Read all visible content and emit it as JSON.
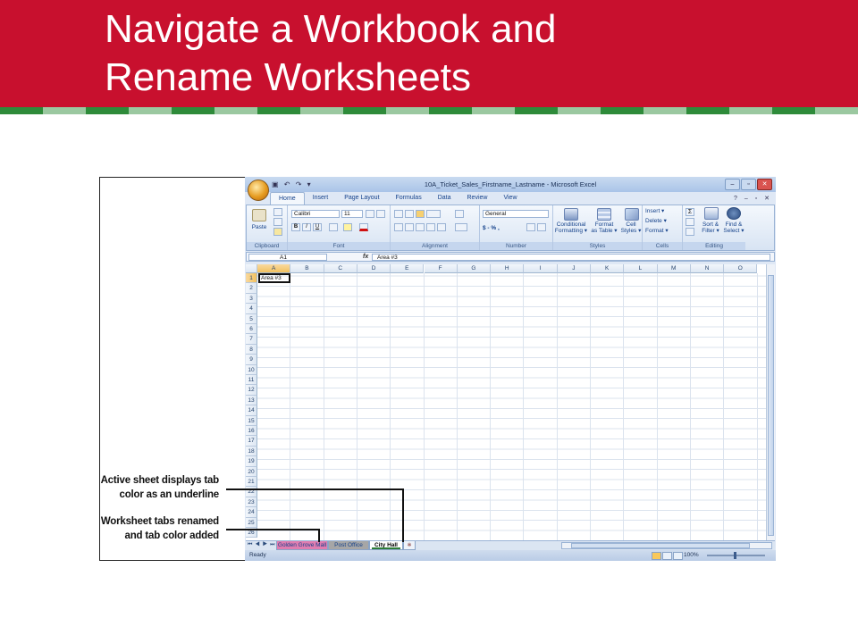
{
  "slide": {
    "title_line1": "Navigate a Workbook and",
    "title_line2": "Rename Worksheets",
    "header_color": "#c8102e"
  },
  "callouts": [
    {
      "line1": "Active sheet displays tab",
      "line2": "color as an underline"
    },
    {
      "line1": "Worksheet tabs renamed",
      "line2": "and tab color added"
    }
  ],
  "excel": {
    "window_title": "10A_Ticket_Sales_Firstname_Lastname - Microsoft Excel",
    "ribbon_tabs": [
      "Home",
      "Insert",
      "Page Layout",
      "Formulas",
      "Data",
      "Review",
      "View"
    ],
    "active_tab": "Home",
    "groups": {
      "clipboard": {
        "label": "Clipboard",
        "paste": "Paste"
      },
      "font": {
        "label": "Font",
        "font_name": "Calibri",
        "font_size": "11"
      },
      "alignment": {
        "label": "Alignment"
      },
      "number": {
        "label": "Number",
        "format": "General",
        "currency": "$ - %  ,"
      },
      "styles": {
        "label": "Styles",
        "conditional": "Conditional",
        "conditional2": "Formatting ▾",
        "format_table": "Format",
        "format_table2": "as Table ▾",
        "cell_styles": "Cell",
        "cell_styles2": "Styles ▾"
      },
      "cells": {
        "label": "Cells",
        "insert": "Insert ▾",
        "delete": "Delete ▾",
        "format": "Format ▾"
      },
      "editing": {
        "label": "Editing",
        "sort": "Sort &",
        "sort2": "Filter ▾",
        "find": "Find &",
        "find2": "Select ▾"
      }
    },
    "name_box": "A1",
    "fx_label": "fx",
    "formula_content": "Area #3",
    "columns": [
      "A",
      "B",
      "C",
      "D",
      "E",
      "F",
      "G",
      "H",
      "I",
      "J",
      "K",
      "L",
      "M",
      "N",
      "O"
    ],
    "rows": [
      "1",
      "2",
      "3",
      "4",
      "5",
      "6",
      "7",
      "8",
      "9",
      "10",
      "11",
      "12",
      "13",
      "14",
      "15",
      "16",
      "17",
      "18",
      "19",
      "20",
      "21",
      "22",
      "23",
      "24",
      "25",
      "26"
    ],
    "cell_a1": "Area #3",
    "sheet_tabs": [
      {
        "label": "Golden Grove Mall",
        "color": "#e07db0",
        "active": false
      },
      {
        "label": "Post Office",
        "color": "#a6a6a6",
        "active": false
      },
      {
        "label": "City Hall",
        "color": "#2e7d3a",
        "active": true
      }
    ],
    "status_text": "Ready",
    "zoom_level": "100%"
  }
}
